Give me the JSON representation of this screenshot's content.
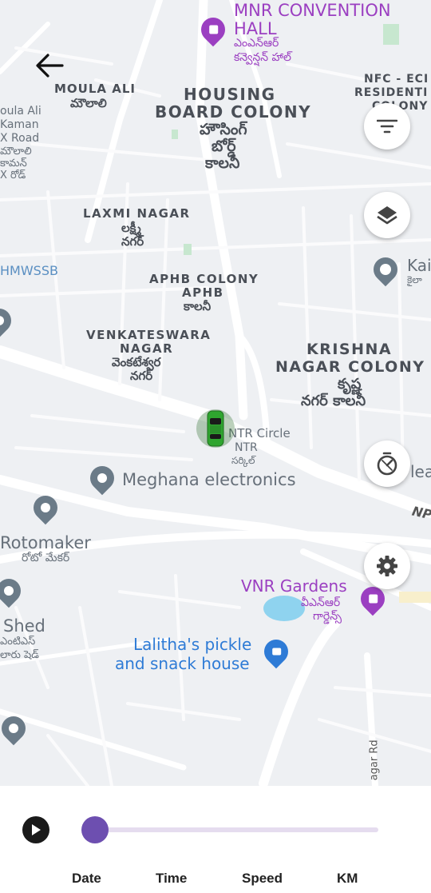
{
  "map": {
    "areas": {
      "housing_board_en_1": "HOUSING",
      "housing_board_en_2": "BOARD COLONY",
      "housing_board_te_1": "హౌసింగ్",
      "housing_board_te_2": "బోర్డ్",
      "housing_board_te_3": "కాలనీ",
      "laxmi_en": "LAXMI NAGAR",
      "laxmi_te_1": "లక్ష్మీ",
      "laxmi_te_2": "నగర్",
      "aphb_en_1": "APHB COLONY",
      "aphb_en_2": "APHB",
      "aphb_te": "కాలనీ",
      "venk_en_1": "VENKATESWARA",
      "venk_en_2": "NAGAR",
      "venk_te_1": "వెంకటేశ్వర",
      "venk_te_2": "నగర్",
      "krishna_en_1": "KRISHNA",
      "krishna_en_2": "NAGAR COLONY",
      "krishna_te_1": "కృష్ణ",
      "krishna_te_2": "నగర్ కాలనీ",
      "moula_en": "MOULA ALI",
      "moula_te": "మౌలాలి",
      "nfc_1": "NFC - ECI",
      "nfc_2": "RESIDENTI",
      "nfc_3": "COLONY",
      "oula_1": "oula Ali",
      "oula_2": "Kaman",
      "oula_3": "X Road",
      "oula_4": "మౌలాలి",
      "oula_5": "కామన్",
      "oula_6": "X రోడ్"
    },
    "pois": {
      "mnr_1": "MNR CONVENTION",
      "mnr_2": "HALL",
      "mnr_te_1": "ఎంఎన్ఆర్",
      "mnr_te_2": "కన్వెన్షన్ హాల్",
      "meghana": "Meghana electronics",
      "ntr_1": "NTR Circle",
      "ntr_2": "NTR",
      "ntr_3": "సర్కిల్",
      "rotomaker": "Rotomaker",
      "rotomaker_te": "రోటో మేకర్",
      "shed": "Shed",
      "shed_te_1": "ఎంటిఎస్",
      "shed_te_2": "లారు షెడ్",
      "vnr_1": "VNR Gardens",
      "vnr_te_1": "వీఎన్ఆర్",
      "vnr_te_2": "గార్డెన్స్",
      "lalitha_1": "Lalitha's pickle",
      "lalitha_2": "and snack house",
      "hmwssb": "HMWSSB",
      "kai": "Kai",
      "kai_te": "కైలా",
      "lea": "lea",
      "npa": "NP",
      "nagar_rd": "agar Rd"
    }
  },
  "controls": {
    "filter_icon": "filter-icon",
    "layers_icon": "layers-icon",
    "speed_icon": "speedometer-icon",
    "settings_icon": "settings-icon",
    "back_icon": "back-arrow-icon",
    "play_icon": "play-icon"
  },
  "playback": {
    "progress": 0,
    "stats": {
      "date": "Date",
      "time": "Time",
      "speed": "Speed",
      "km": "KM"
    }
  },
  "colors": {
    "accent": "#6d4fb0",
    "track": "#e5dcef",
    "vehicle": "#2fa52f",
    "poi_purple": "#9b3fc1",
    "poi_blue": "#2e7bd6",
    "poi_gray": "#6b7b88"
  }
}
